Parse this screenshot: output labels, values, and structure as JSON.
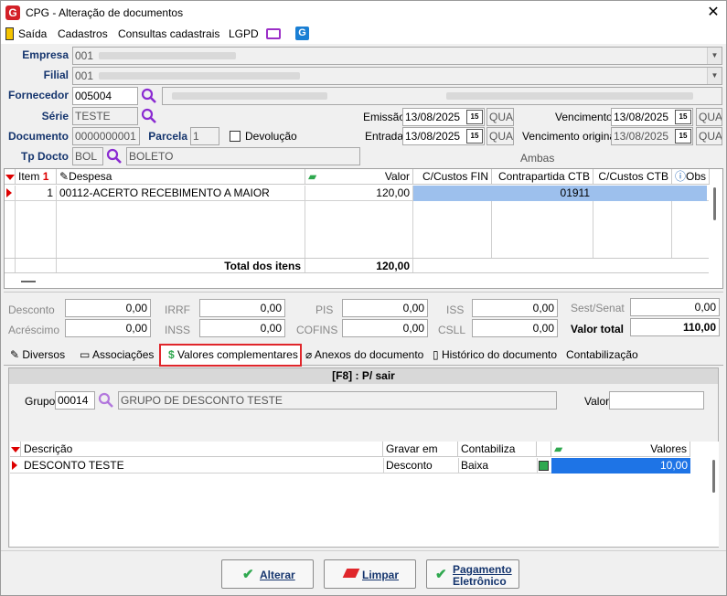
{
  "window": {
    "title": "CPG - Alteração de documentos",
    "close": "✕",
    "logo": "G"
  },
  "menu": {
    "items": [
      "Saída",
      "Cadastros",
      "Consultas cadastrais",
      "LGPD"
    ]
  },
  "form": {
    "empresa_label": "Empresa",
    "empresa_value": "001",
    "filial_label": "Filial",
    "filial_value": "001",
    "fornecedor_label": "Fornecedor",
    "fornecedor_value": "005004",
    "serie_label": "Série",
    "serie_value": "TESTE",
    "emissao_label": "Emissão",
    "emissao_value": "13/08/2025",
    "emissao_day": "QUA",
    "vencimento_label": "Vencimento",
    "vencimento_value": "13/08/2025",
    "vencimento_day": "QUA",
    "documento_label": "Documento",
    "documento_value": "0000000001",
    "parcela_label": "Parcela",
    "parcela_value": "1",
    "devolucao_label": "Devolução",
    "entrada_label": "Entrada",
    "entrada_value": "13/08/2025",
    "entrada_day": "QUA",
    "venc_original_label": "Vencimento original",
    "venc_original_value": "13/08/2025",
    "venc_original_day": "QUA",
    "tpdocto_label": "Tp Docto",
    "tpdocto_code": "BOL",
    "tpdocto_desc": "BOLETO",
    "ambas_label": "Ambas"
  },
  "items_grid": {
    "headers": [
      "Item",
      "Despesa",
      "Valor",
      "C/Custos FIN",
      "Contrapartida CTB",
      "C/Custos CTB",
      "Obs"
    ],
    "rows": [
      {
        "item": "1",
        "despesa": "00112-ACERTO RECEBIMENTO A MAIOR",
        "valor": "120,00",
        "contrapartida": "01911"
      }
    ],
    "total_label": "Total dos itens",
    "total_value": "120,00"
  },
  "totals": {
    "desconto_label": "Desconto",
    "desconto": "0,00",
    "irrf_label": "IRRF",
    "irrf": "0,00",
    "pis_label": "PIS",
    "pis": "0,00",
    "iss_label": "ISS",
    "iss": "0,00",
    "sestsenat_label": "Sest/Senat",
    "sestsenat": "0,00",
    "acrescimo_label": "Acréscimo",
    "acrescimo": "0,00",
    "inss_label": "INSS",
    "inss": "0,00",
    "cofins_label": "COFINS",
    "cofins": "0,00",
    "csll_label": "CSLL",
    "csll": "0,00",
    "valor_total_label": "Valor total",
    "valor_total": "110,00"
  },
  "tabs": [
    "Diversos",
    "Associações",
    "Valores complementares",
    "Anexos do documento",
    "Histórico do documento",
    "Contabilização"
  ],
  "panel": {
    "header": "[F8] : P/ sair",
    "grupo_label": "Grupo",
    "grupo_code": "00014",
    "grupo_desc": "GRUPO DE DESCONTO TESTE",
    "valor_label": "Valor",
    "grid_headers": [
      "Descrição",
      "Gravar em",
      "Contabiliza",
      "Valores"
    ],
    "grid_row": {
      "descricao": "DESCONTO TESTE",
      "gravar": "Desconto",
      "contabiliza": "Baixa",
      "valor": "10,00"
    }
  },
  "buttons": {
    "alterar": "Alterar",
    "limpar": "Limpar",
    "pagamento1": "Pagamento",
    "pagamento2": "Eletrônico"
  },
  "colors": {
    "accent": "#15356e",
    "selection": "#9dc0ed",
    "highlight": "#e0262b",
    "check": "#2fa84f"
  }
}
